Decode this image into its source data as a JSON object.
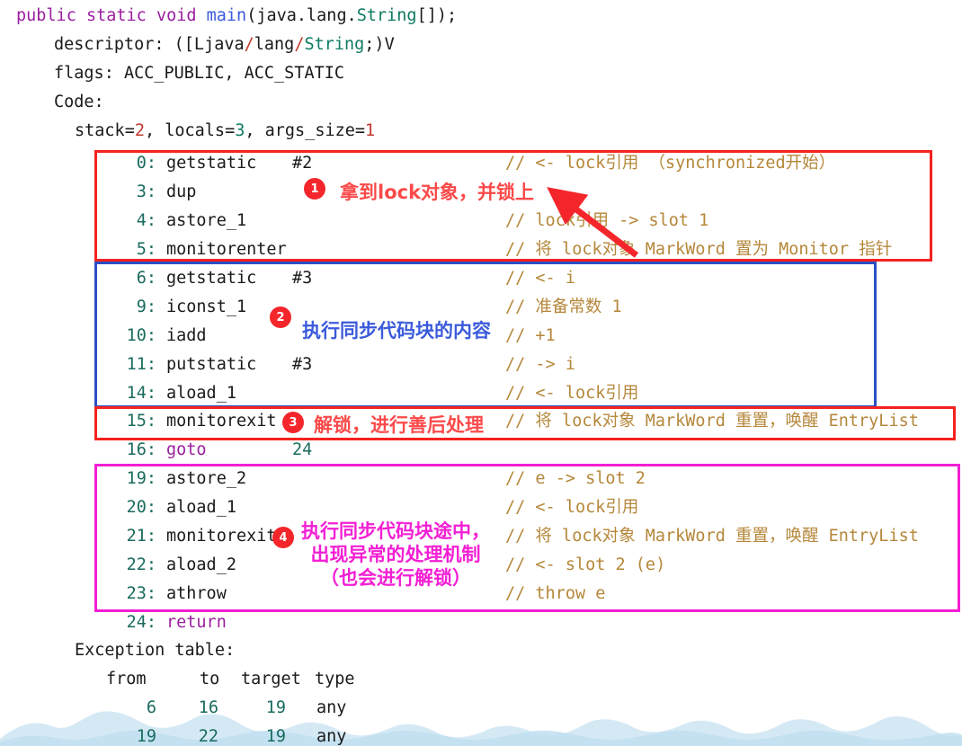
{
  "header": {
    "signature_parts": [
      {
        "t": "public ",
        "c": "kw"
      },
      {
        "t": "static ",
        "c": "kw"
      },
      {
        "t": "void ",
        "c": "kw"
      },
      {
        "t": "main",
        "c": "meth"
      },
      {
        "t": "(java.lang.",
        "c": "op"
      },
      {
        "t": "String",
        "c": "typ"
      },
      {
        "t": "[]);",
        "c": "op"
      }
    ],
    "descriptor_label": "descriptor: ([Ljava",
    "descriptor_sep1": "/",
    "descriptor_mid": "lang",
    "descriptor_sep2": "/",
    "descriptor_type": "String",
    "descriptor_tail": ";)V",
    "flags_line": "flags: ACC_PUBLIC, ACC_STATIC",
    "code_label": "Code:",
    "stack_prefix": "stack=",
    "stack_value": "2",
    "locals_prefix": ", locals=",
    "locals_value": "3",
    "args_prefix": ", args_size=",
    "args_value": "1"
  },
  "instructions": [
    {
      "idx": "0:",
      "op": "getstatic",
      "arg": "#2",
      "comment": "// <- lock引用 （synchronized开始）"
    },
    {
      "idx": "3:",
      "op": "dup",
      "arg": "",
      "comment": ""
    },
    {
      "idx": "4:",
      "op": "astore_1",
      "arg": "",
      "comment": "// lock引用 -> slot 1"
    },
    {
      "idx": "5:",
      "op": "monitorenter",
      "arg": "",
      "comment": "// 将 lock对象 MarkWord 置为 Monitor 指针"
    },
    {
      "idx": "6:",
      "op": "getstatic",
      "arg": "#3",
      "comment": "// <- i"
    },
    {
      "idx": "9:",
      "op": "iconst_1",
      "arg": "",
      "comment": "// 准备常数 1"
    },
    {
      "idx": "10:",
      "op": "iadd",
      "arg": "",
      "comment": "// +1"
    },
    {
      "idx": "11:",
      "op": "putstatic",
      "arg": "#3",
      "comment": "// -> i"
    },
    {
      "idx": "14:",
      "op": "aload_1",
      "arg": "",
      "comment": "// <- lock引用"
    },
    {
      "idx": "15:",
      "op": "monitorexit",
      "arg": "",
      "comment": "// 将 lock对象 MarkWord 重置，唤醒 EntryList"
    },
    {
      "idx": "16:",
      "op": "goto",
      "arg": "24",
      "comment": "",
      "op_class": "kw",
      "arg_class": "tealnum"
    },
    {
      "idx": "19:",
      "op": "astore_2",
      "arg": "",
      "comment": "// e -> slot 2"
    },
    {
      "idx": "20:",
      "op": "aload_1",
      "arg": "",
      "comment": "// <- lock引用"
    },
    {
      "idx": "21:",
      "op": "monitorexit",
      "arg": "",
      "comment": "// 将 lock对象 MarkWord 重置，唤醒 EntryList"
    },
    {
      "idx": "22:",
      "op": "aload_2",
      "arg": "",
      "comment": "// <- slot 2 (e)"
    },
    {
      "idx": "23:",
      "op": "athrow",
      "arg": "",
      "comment": "// throw e"
    },
    {
      "idx": "24:",
      "op": "return",
      "arg": "",
      "comment": "",
      "op_class": "kw"
    }
  ],
  "exception_table": {
    "title": "Exception table:",
    "headers": [
      "from",
      "to",
      "target",
      "type"
    ],
    "rows": [
      {
        "from": "6",
        "to": "16",
        "target": "19",
        "type": "any"
      },
      {
        "from": "19",
        "to": "22",
        "target": "19",
        "type": "any"
      }
    ]
  },
  "annotations": [
    {
      "num": "1",
      "text": "拿到lock对象，并锁上",
      "color": "#fb4a4a"
    },
    {
      "num": "2",
      "text": "执行同步代码块的内容",
      "color": "#3b5bdb"
    },
    {
      "num": "3",
      "text": "解锁，进行善后处理",
      "color": "#fb4a4a"
    },
    {
      "num": "4",
      "text": "执行同步代码块途中，\n出现异常的处理机制\n（也会进行解锁）",
      "color": "#f31fd4"
    }
  ],
  "boxes": [
    {
      "name": "monitorenter-block",
      "color": "#f5221f"
    },
    {
      "name": "sync-body-block",
      "color": "#2b4fc4"
    },
    {
      "name": "monitorexit-block",
      "color": "#f5221f"
    },
    {
      "name": "exception-handler-block",
      "color": "#f31fd4"
    }
  ],
  "colors": {
    "red": "#f5221f",
    "blue": "#2b4fc4",
    "magenta": "#f31fd4",
    "badge": "#f4262b",
    "comment": "#b5873a",
    "teal": "#1a6b5e",
    "purple": "#9b1fa0",
    "wave": "#cfe6f2"
  }
}
